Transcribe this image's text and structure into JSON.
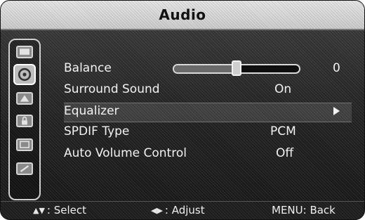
{
  "window": {
    "title": "Audio"
  },
  "sidebar": {
    "items": [
      {
        "icon": "picture-icon"
      },
      {
        "icon": "audio-icon"
      },
      {
        "icon": "channel-icon"
      },
      {
        "icon": "lock-icon"
      },
      {
        "icon": "setup-icon"
      },
      {
        "icon": "input-icon"
      }
    ]
  },
  "menu": {
    "items": [
      {
        "label": "Balance",
        "value": "0",
        "slider_position_fraction": 0.5
      },
      {
        "label": "Surround Sound",
        "value": "On"
      },
      {
        "label": "Equalizer",
        "value": "▶"
      },
      {
        "label": "SPDIF Type",
        "value": "PCM"
      },
      {
        "label": "Auto Volume Control",
        "value": "Off"
      }
    ]
  },
  "footer": {
    "select_icon": "up-down-arrows-icon",
    "select": ": Select",
    "adjust_icon": "left-right-arrows-icon",
    "adjust": ": Adjust",
    "back": "MENU: Back"
  }
}
